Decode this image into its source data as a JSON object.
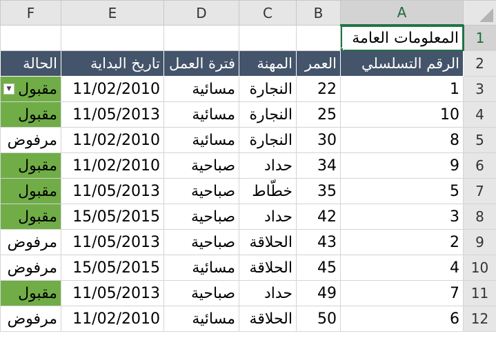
{
  "columns": [
    "F",
    "E",
    "D",
    "C",
    "B",
    "A"
  ],
  "selected_column": "A",
  "selected_row": "1",
  "title_cell": "المعلومات العامة",
  "headers": {
    "status": "الحالة",
    "start_date": "تاريخ البداية",
    "shift": "فترة العمل",
    "profession": "المهنة",
    "age": "العمر",
    "serial": "الرقم التسلسلي"
  },
  "rows": [
    {
      "row": "3",
      "serial": "1",
      "age": "22",
      "profession": "النجارة",
      "shift": "مسائية",
      "start_date": "11/02/2010",
      "status": "مقبول",
      "accepted": true
    },
    {
      "row": "4",
      "serial": "10",
      "age": "25",
      "profession": "النجارة",
      "shift": "مسائية",
      "start_date": "11/05/2013",
      "status": "مقبول",
      "accepted": true
    },
    {
      "row": "5",
      "serial": "8",
      "age": "30",
      "profession": "النجارة",
      "shift": "مسائية",
      "start_date": "11/02/2010",
      "status": "مرفوض",
      "accepted": false
    },
    {
      "row": "6",
      "serial": "9",
      "age": "34",
      "profession": "حداد",
      "shift": "صباحية",
      "start_date": "11/02/2010",
      "status": "مقبول",
      "accepted": true
    },
    {
      "row": "7",
      "serial": "5",
      "age": "35",
      "profession": "خطّاط",
      "shift": "صباحية",
      "start_date": "11/05/2013",
      "status": "مقبول",
      "accepted": true
    },
    {
      "row": "8",
      "serial": "3",
      "age": "42",
      "profession": "حداد",
      "shift": "صباحية",
      "start_date": "15/05/2015",
      "status": "مقبول",
      "accepted": true
    },
    {
      "row": "9",
      "serial": "2",
      "age": "43",
      "profession": "الحلاقة",
      "shift": "صباحية",
      "start_date": "11/05/2013",
      "status": "مرفوض",
      "accepted": false
    },
    {
      "row": "10",
      "serial": "4",
      "age": "45",
      "profession": "الحلاقة",
      "shift": "مسائية",
      "start_date": "15/05/2015",
      "status": "مرفوض",
      "accepted": false
    },
    {
      "row": "11",
      "serial": "7",
      "age": "49",
      "profession": "حداد",
      "shift": "صباحية",
      "start_date": "11/05/2013",
      "status": "مقبول",
      "accepted": true
    },
    {
      "row": "12",
      "serial": "6",
      "age": "50",
      "profession": "الحلاقة",
      "shift": "مسائية",
      "start_date": "11/02/2010",
      "status": "مرفوض",
      "accepted": false
    }
  ],
  "colors": {
    "header_fill": "#44546a",
    "accepted_fill": "#70ad47",
    "selection_green": "#217346"
  },
  "icons": {
    "dropdown": "dropdown-arrow-icon",
    "corner": "select-all-triangle-icon"
  }
}
